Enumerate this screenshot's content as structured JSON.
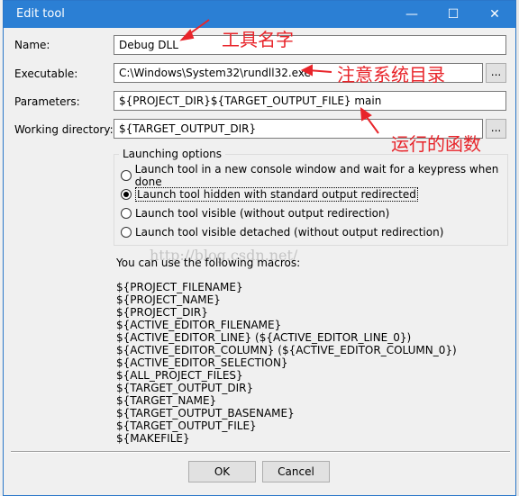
{
  "window": {
    "title": "Edit tool",
    "minimize_glyph": "—",
    "maximize_glyph": "☐",
    "close_glyph": "✕"
  },
  "form": {
    "name_label": "Name:",
    "name_value": "Debug DLL",
    "executable_label": "Executable:",
    "executable_value": "C:\\Windows\\System32\\rundll32.exe",
    "parameters_label": "Parameters:",
    "parameters_value": "${PROJECT_DIR}${TARGET_OUTPUT_FILE} main",
    "workdir_label": "Working directory:",
    "workdir_value": "${TARGET_OUTPUT_DIR}",
    "browse_label": "..."
  },
  "launching": {
    "title": "Launching options",
    "options": [
      {
        "label": "Launch tool in a new console window and wait for a keypress when done",
        "checked": false
      },
      {
        "label": "Launch tool hidden with standard output redirected",
        "checked": true
      },
      {
        "label": "Launch tool visible (without output redirection)",
        "checked": false
      },
      {
        "label": "Launch tool visible detached (without output redirection)",
        "checked": false
      }
    ]
  },
  "macros": {
    "intro": "You can use the following macros:",
    "items": [
      "${PROJECT_FILENAME}",
      "${PROJECT_NAME}",
      "${PROJECT_DIR}",
      "${ACTIVE_EDITOR_FILENAME}",
      "${ACTIVE_EDITOR_LINE} (${ACTIVE_EDITOR_LINE_0})",
      "${ACTIVE_EDITOR_COLUMN} (${ACTIVE_EDITOR_COLUMN_0})",
      "${ACTIVE_EDITOR_SELECTION}",
      "${ALL_PROJECT_FILES}",
      "${TARGET_OUTPUT_DIR}",
      "${TARGET_NAME}",
      "${TARGET_OUTPUT_BASENAME}",
      "${TARGET_OUTPUT_FILE}",
      "${MAKEFILE}"
    ]
  },
  "buttons": {
    "ok": "OK",
    "cancel": "Cancel"
  },
  "annotations": {
    "tool_name": "工具名字",
    "system_dir": "注意系统目录",
    "run_function": "运行的函数",
    "color": "#e8242a"
  },
  "watermark": "http://blog.csdn.net/"
}
